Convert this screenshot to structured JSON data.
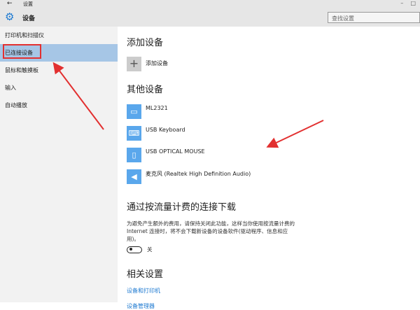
{
  "window": {
    "title": "设置",
    "back": "←",
    "minimize": "–",
    "maximize": "□"
  },
  "header": {
    "title": "设备",
    "search_placeholder": "查找设置"
  },
  "sidebar": {
    "items": [
      {
        "label": "打印机和扫描仪"
      },
      {
        "label": "已连接设备",
        "selected": true
      },
      {
        "label": "鼠标和触摸板"
      },
      {
        "label": "输入"
      },
      {
        "label": "自动播放"
      }
    ]
  },
  "content": {
    "add_section": {
      "title": "添加设备",
      "add_label": "添加设备"
    },
    "other_section": {
      "title": "其他设备",
      "devices": [
        {
          "name": "ML2321",
          "icon": "monitor-icon"
        },
        {
          "name": "USB Keyboard",
          "icon": "keyboard-icon"
        },
        {
          "name": "USB OPTICAL MOUSE",
          "icon": "mouse-icon"
        },
        {
          "name": "麦克风 (Realtek High Definition Audio)",
          "icon": "speaker-icon"
        }
      ]
    },
    "metered": {
      "title": "通过按流量计费的连接下载",
      "description": "为避免产生额外的费用，请保持关闭此功能，这样当你使用按流量计费的 Internet 连接时，将不会下载新设备的设备软件(驱动程序、信息和应用)。",
      "toggle_label": "关",
      "toggle_on": false
    },
    "related": {
      "title": "相关设置",
      "links": [
        "设备和打印机",
        "设备管理器"
      ]
    }
  },
  "colors": {
    "accent": "#1e7ad1",
    "selected": "#a6c6e6",
    "annotation": "#e23030"
  }
}
